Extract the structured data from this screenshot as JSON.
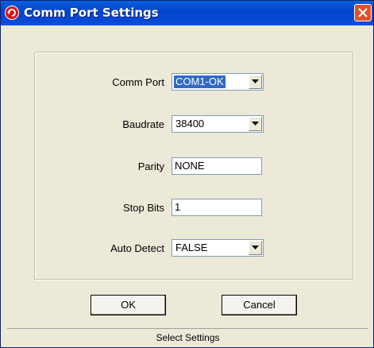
{
  "window": {
    "title": "Comm Port Settings"
  },
  "form": {
    "comm_port": {
      "label": "Comm Port",
      "value": "COM1-OK"
    },
    "baudrate": {
      "label": "Baudrate",
      "value": "38400"
    },
    "parity": {
      "label": "Parity",
      "value": "NONE"
    },
    "stop_bits": {
      "label": "Stop Bits",
      "value": "1"
    },
    "auto_detect": {
      "label": "Auto Detect",
      "value": "FALSE"
    }
  },
  "buttons": {
    "ok": "OK",
    "cancel": "Cancel"
  },
  "status": {
    "text": "Select Settings"
  },
  "colors": {
    "titlebar": "#0548d6",
    "close": "#e0502a",
    "selection": "#316ac5",
    "dialog_bg": "#ece9d8"
  },
  "icons": {
    "app": "app-red-circle-icon",
    "close": "close-icon",
    "dropdown": "chevron-down-icon"
  }
}
